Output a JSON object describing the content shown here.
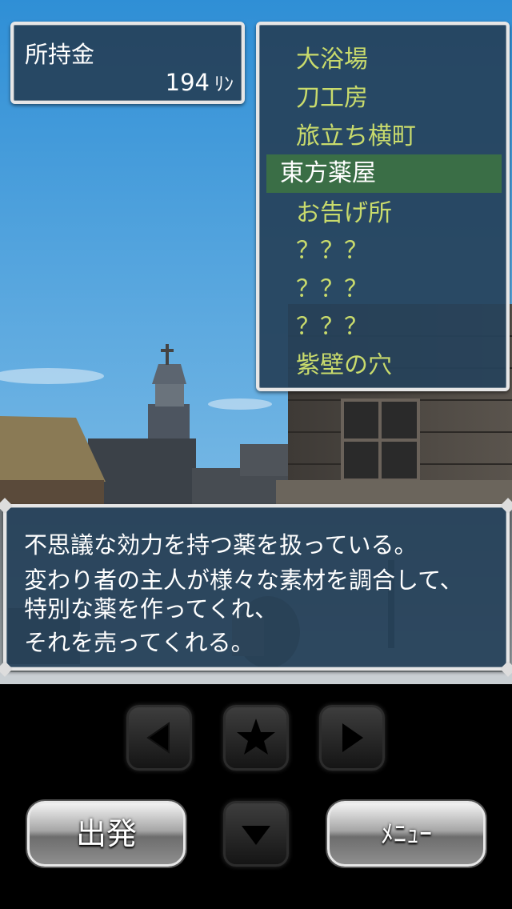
{
  "money": {
    "label": "所持金",
    "amount": "194",
    "currency": "ﾘﾝ"
  },
  "location_menu": {
    "items": [
      {
        "label": "大浴場",
        "selected": false
      },
      {
        "label": "刀工房",
        "selected": false
      },
      {
        "label": "旅立ち横町",
        "selected": false
      },
      {
        "label": "東方薬屋",
        "selected": true
      },
      {
        "label": "お告げ所",
        "selected": false
      },
      {
        "label": "？？？",
        "selected": false
      },
      {
        "label": "？？？",
        "selected": false
      },
      {
        "label": "？？？",
        "selected": false
      },
      {
        "label": "紫壁の穴",
        "selected": false
      }
    ],
    "item_color": "#c9db6c",
    "selected_bg": "#3a6e46"
  },
  "dialog": {
    "lines": [
      "不思議な効力を持つ薬を扱っている。",
      "変わり者の主人が様々な素材を調合して、",
      "特別な薬を作ってくれ、",
      "それを売ってくれる。"
    ]
  },
  "controls": {
    "left_icon": "triangle-left-icon",
    "star_icon": "star-icon",
    "right_icon": "triangle-right-icon",
    "down_icon": "triangle-down-icon",
    "depart_label": "出発",
    "menu_label": "ﾒﾆｭｰ"
  },
  "colors": {
    "panel_bg": "#26425a",
    "panel_border": "#e6e6e6"
  }
}
